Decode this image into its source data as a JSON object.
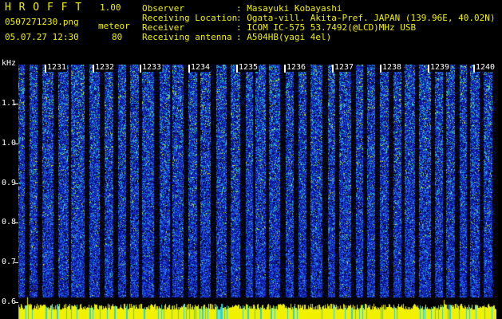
{
  "header": {
    "app_title": "H R O F F T",
    "version": "1.00",
    "filename": "0507271230.png",
    "mode": "meteor",
    "datetime": "05.07.27 12:30",
    "count": "80"
  },
  "info": {
    "rows": [
      {
        "label": "Observer",
        "value": ": Masayuki Kobayashi"
      },
      {
        "label": "Receiving Location",
        "value": ": Ogata-vill. Akita-Pref. JAPAN (139.96E, 40.02N)"
      },
      {
        "label": "Receiver",
        "value": ": ICOM IC-575 53.7492(@LCD)MHz USB"
      },
      {
        "label": "Receiving antenna",
        "value": ": A504HB(yagi 4el)"
      }
    ]
  },
  "axis": {
    "y_unit": "kHz",
    "y_ticks": [
      "1.1",
      "1.0",
      "0.9",
      "0.8",
      "0.7",
      "0.6"
    ],
    "time_ticks": [
      "1231",
      "1232",
      "1233",
      "1234",
      "1235",
      "1236",
      "1237",
      "1238",
      "1239",
      "1240"
    ]
  },
  "colors": {
    "background": "#000000",
    "label_yellow": "#f0f000",
    "label_green": "#1fd21f",
    "spectrum_blue": "#1f3cff",
    "spectrum_cyan": "#1fe0e0",
    "band_yellow": "#f0f000"
  }
}
